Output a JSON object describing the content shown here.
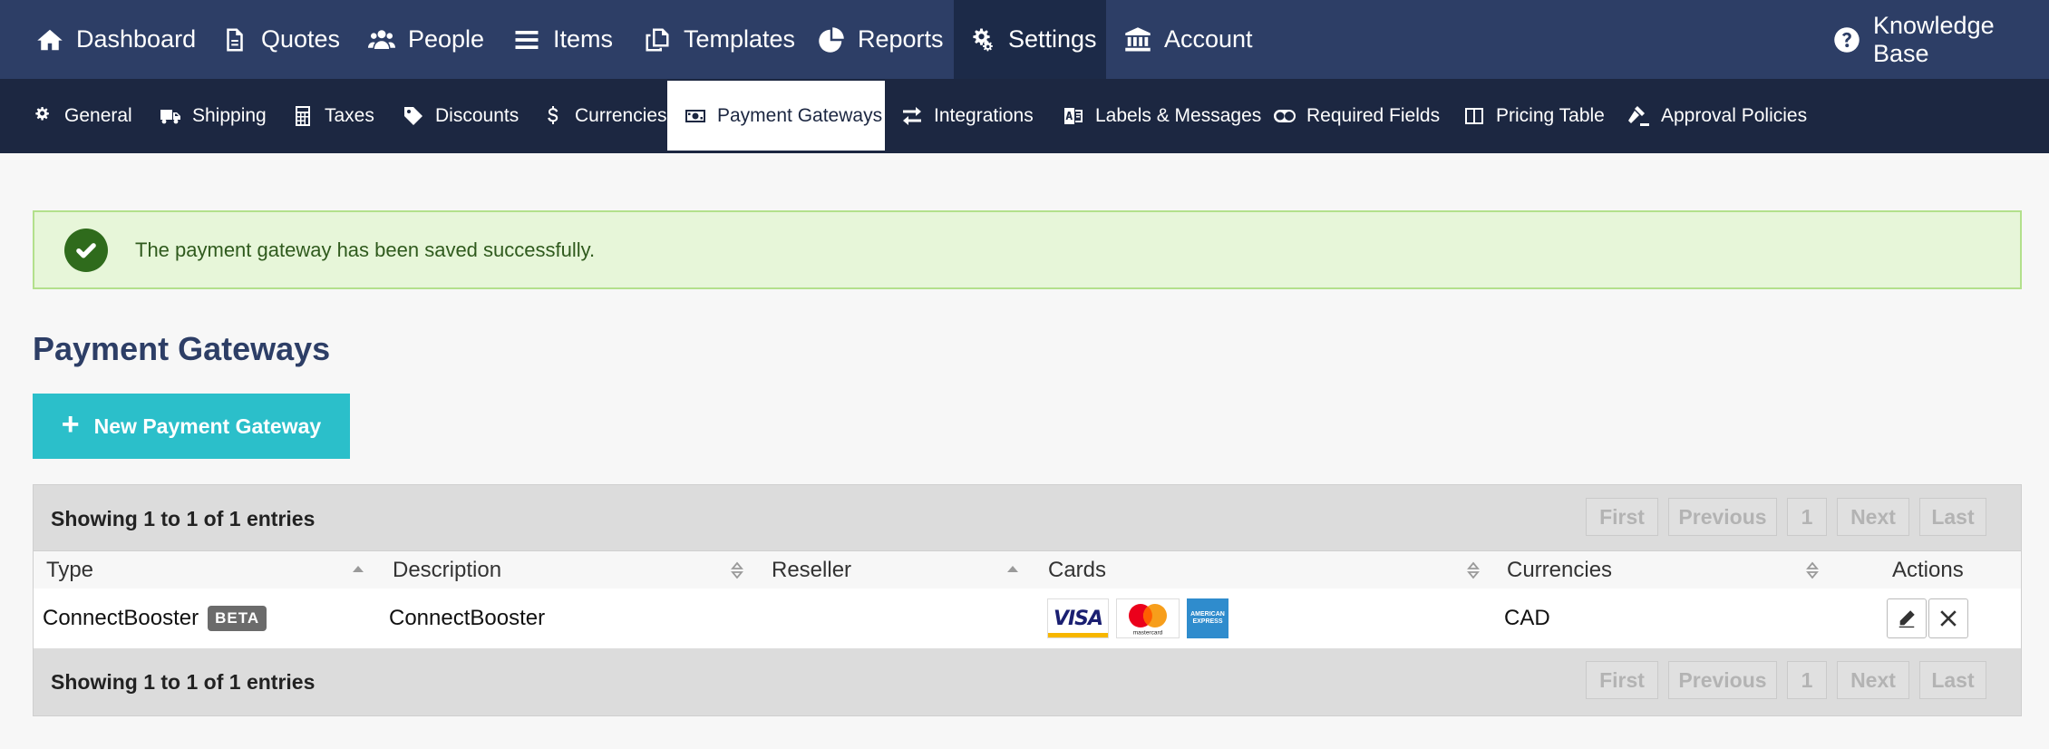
{
  "topnav": {
    "items": [
      {
        "label": "Dashboard",
        "icon": "home-icon"
      },
      {
        "label": "Quotes",
        "icon": "document-icon"
      },
      {
        "label": "People",
        "icon": "people-icon"
      },
      {
        "label": "Items",
        "icon": "list-icon"
      },
      {
        "label": "Templates",
        "icon": "copy-icon"
      },
      {
        "label": "Reports",
        "icon": "pie-chart-icon"
      },
      {
        "label": "Settings",
        "icon": "gears-icon",
        "active": true
      },
      {
        "label": "Account",
        "icon": "bank-icon"
      }
    ],
    "help": {
      "label": "Knowledge Base",
      "icon": "question-circle-icon"
    }
  },
  "subnav": {
    "items": [
      {
        "label": "General",
        "icon": "gears-icon"
      },
      {
        "label": "Shipping",
        "icon": "truck-icon"
      },
      {
        "label": "Taxes",
        "icon": "calculator-icon"
      },
      {
        "label": "Discounts",
        "icon": "tag-icon"
      },
      {
        "label": "Currencies",
        "icon": "dollar-icon"
      },
      {
        "label": "Payment Gateways",
        "icon": "money-icon",
        "active": true
      },
      {
        "label": "Integrations",
        "icon": "exchange-icon"
      },
      {
        "label": "Labels & Messages",
        "icon": "language-icon"
      },
      {
        "label": "Required Fields",
        "icon": "toggle-icon"
      },
      {
        "label": "Pricing Table",
        "icon": "columns-icon"
      },
      {
        "label": "Approval Policies",
        "icon": "gavel-icon"
      }
    ]
  },
  "alert": {
    "message": "The payment gateway has been saved successfully.",
    "icon": "check-circle-icon",
    "color": "#2f6b1c"
  },
  "page": {
    "title": "Payment Gateways"
  },
  "new_button": {
    "label": "New Payment Gateway",
    "icon": "plus-icon",
    "color": "#2bbfca"
  },
  "table": {
    "info_top": "Showing 1 to 1 of 1 entries",
    "info_bottom": "Showing 1 to 1 of 1 entries",
    "pager": {
      "first": "First",
      "previous": "Previous",
      "page": "1",
      "next": "Next",
      "last": "Last"
    },
    "columns": [
      "Type",
      "Description",
      "Reseller",
      "Cards",
      "Currencies",
      "Actions"
    ],
    "rows": [
      {
        "type": "ConnectBooster",
        "badge": "BETA",
        "description": "ConnectBooster",
        "reseller": "",
        "cards": [
          "visa-card-icon",
          "mastercard-card-icon",
          "amex-card-icon"
        ],
        "card_text": {
          "visa": "VISA",
          "mastercard": "mastercard",
          "amex": "AMERICAN EXPRESS"
        },
        "currencies": "CAD",
        "actions": [
          "edit-icon",
          "delete-icon"
        ]
      }
    ]
  }
}
